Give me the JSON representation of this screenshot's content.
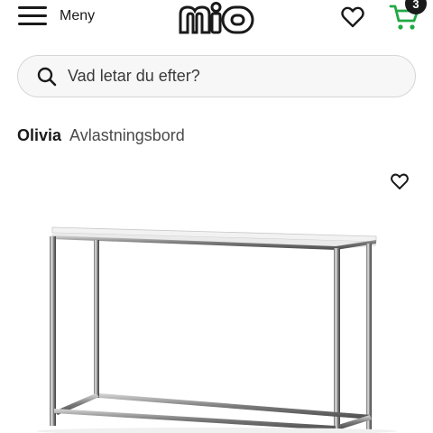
{
  "header": {
    "menu_label": "Meny",
    "logo_text": "mio",
    "cart_count": "3",
    "icons": [
      "hamburger-icon",
      "heart-icon",
      "cart-icon"
    ]
  },
  "search": {
    "placeholder": "Vad letar du efter?"
  },
  "product": {
    "brand": "Olivia",
    "type": "Avlastningsbord"
  },
  "colors": {
    "accent_green": "#22a845",
    "text": "#1a1a1a",
    "search_bg": "#f7f7f7"
  }
}
